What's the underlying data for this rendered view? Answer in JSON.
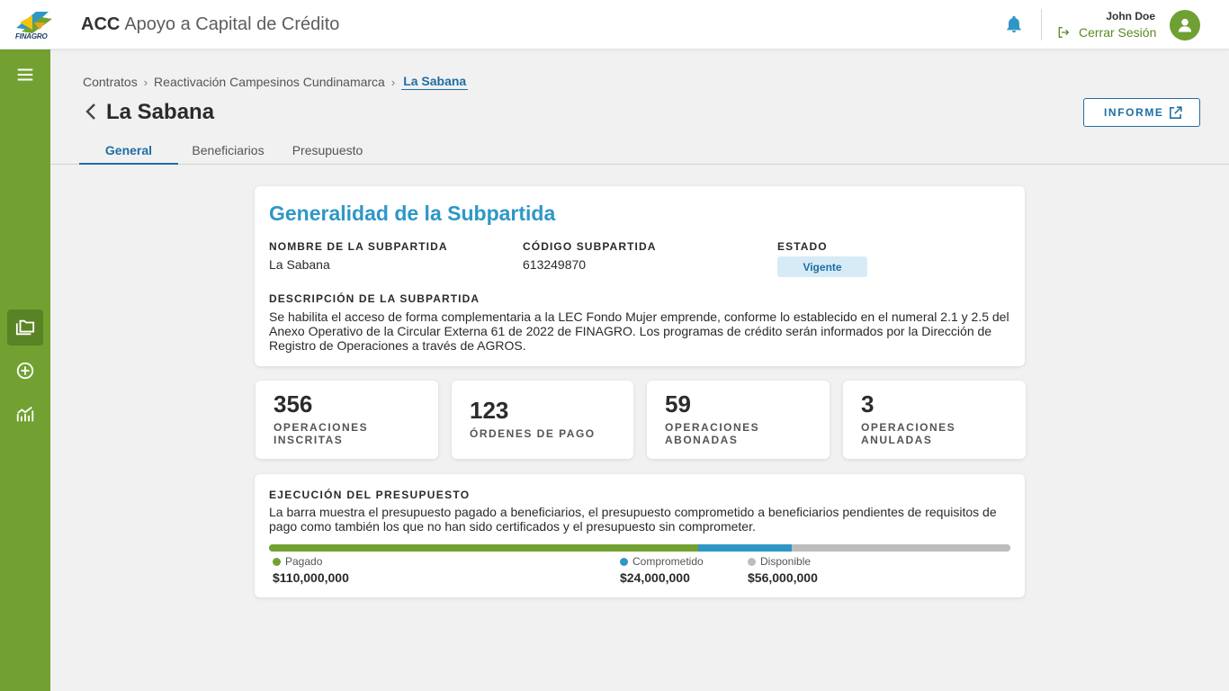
{
  "header": {
    "logo_text": "FINAGRO",
    "app_abbr": "ACC",
    "app_title": "Apoyo a Capital de Crédito",
    "user_name": "John Doe",
    "logout_label": "Cerrar Sesión"
  },
  "breadcrumb": {
    "items": [
      "Contratos",
      "Reactivación Campesinos Cundinamarca"
    ],
    "current": "La Sabana"
  },
  "page": {
    "title": "La Sabana",
    "report_button": "INFORME"
  },
  "tabs": [
    {
      "label": "General",
      "active": true
    },
    {
      "label": "Beneficiarios",
      "active": false
    },
    {
      "label": "Presupuesto",
      "active": false
    }
  ],
  "general": {
    "heading": "Generalidad de la Subpartida",
    "name_label": "NOMBRE DE LA SUBPARTIDA",
    "name_value": "La Sabana",
    "code_label": "CÓDIGO SUBPARTIDA",
    "code_value": "613249870",
    "status_label": "ESTADO",
    "status_value": "Vigente",
    "desc_label": "DESCRIPCIÓN DE LA SUBPARTIDA",
    "desc_value": "Se habilita el acceso de forma complementaria a la LEC Fondo Mujer emprende, conforme lo establecido en el numeral 2.1 y 2.5 del Anexo Operativo de la Circular Externa 61 de 2022 de FINAGRO. Los programas de crédito serán informados por la Dirección de Registro de Operaciones a través de AGROS."
  },
  "stats": [
    {
      "value": "356",
      "label": "OPERACIONES INSCRITAS"
    },
    {
      "value": "123",
      "label": "ÓRDENES DE PAGO"
    },
    {
      "value": "59",
      "label": "OPERACIONES ABONADAS"
    },
    {
      "value": "3",
      "label": "OPERACIONES ANULADAS"
    }
  ],
  "budget": {
    "title": "EJECUCIÓN DEL PRESUPUESTO",
    "description": "La barra muestra el presupuesto pagado a beneficiarios, el presupuesto comprometido a beneficiarios pendientes de requisitos de pago como también los que no han sido certificados y el presupuesto sin comprometer.",
    "segments": [
      {
        "label": "Pagado",
        "amount": "$110,000,000",
        "value": 110000000,
        "color": "#72a132"
      },
      {
        "label": "Comprometido",
        "amount": "$24,000,000",
        "value": 24000000,
        "color": "#2e97c7"
      },
      {
        "label": "Disponible",
        "amount": "$56,000,000",
        "value": 56000000,
        "color": "#bdbdbd"
      }
    ]
  },
  "colors": {
    "brand_green": "#72a132",
    "accent_blue": "#1f6ea3",
    "heading_blue": "#2e97c7"
  },
  "icons": {
    "sidebar": [
      "menu-icon",
      "folders-icon",
      "add-circle-icon",
      "chart-icon"
    ],
    "header": [
      "finagro-logo",
      "bell-icon",
      "logout-icon",
      "user-avatar-icon"
    ]
  }
}
